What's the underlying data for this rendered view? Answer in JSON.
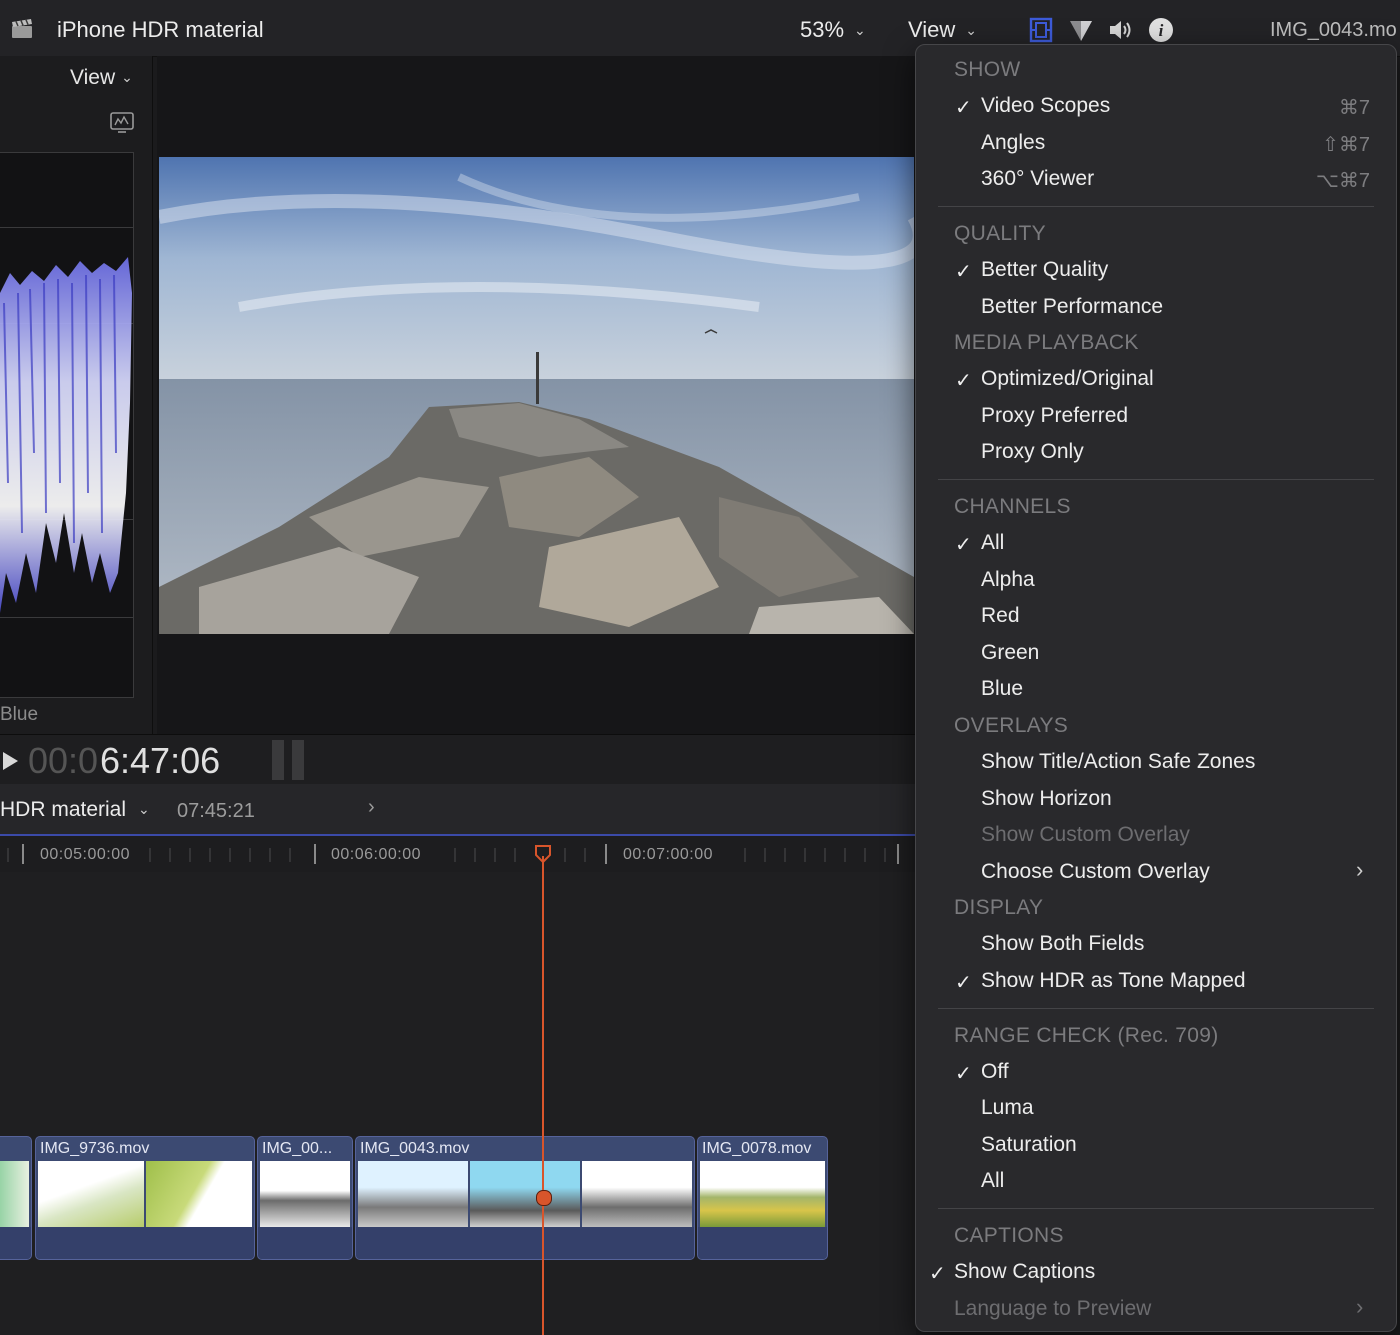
{
  "topbar": {
    "project_title": "iPhone HDR material",
    "zoom": "53%",
    "view_label": "View",
    "clip_name": "IMG_0043.mo",
    "accent_color": "#3d5bd9"
  },
  "scope": {
    "view_label": "View",
    "channel_label": "Blue"
  },
  "transport": {
    "timecode_dim": "00:0",
    "timecode_main": "6:47:06"
  },
  "timeline": {
    "project_name": "HDR material",
    "duration": "07:45:21",
    "ruler_labels": [
      "00:05:00:00",
      "00:06:00:00",
      "00:07:00:00"
    ],
    "clips": [
      {
        "name": ""
      },
      {
        "name": "IMG_9736.mov"
      },
      {
        "name": "IMG_00..."
      },
      {
        "name": "IMG_0043.mov"
      },
      {
        "name": "IMG_0078.mov"
      }
    ],
    "playhead_color": "#d8552b"
  },
  "menu": {
    "show": {
      "header": "SHOW",
      "items": [
        {
          "label": "Video Scopes",
          "checked": true,
          "shortcut": "⌘7"
        },
        {
          "label": "Angles",
          "checked": false,
          "shortcut": "⇧⌘7"
        },
        {
          "label": "360° Viewer",
          "checked": false,
          "shortcut": "⌥⌘7"
        }
      ]
    },
    "quality": {
      "header": "QUALITY",
      "items": [
        {
          "label": "Better Quality",
          "checked": true
        },
        {
          "label": "Better Performance",
          "checked": false
        }
      ]
    },
    "media_playback": {
      "header": "MEDIA PLAYBACK",
      "items": [
        {
          "label": "Optimized/Original",
          "checked": true
        },
        {
          "label": "Proxy Preferred",
          "checked": false
        },
        {
          "label": "Proxy Only",
          "checked": false
        }
      ]
    },
    "channels": {
      "header": "CHANNELS",
      "items": [
        {
          "label": "All",
          "checked": true
        },
        {
          "label": "Alpha",
          "checked": false
        },
        {
          "label": "Red",
          "checked": false
        },
        {
          "label": "Green",
          "checked": false
        },
        {
          "label": "Blue",
          "checked": false
        }
      ]
    },
    "overlays": {
      "header": "OVERLAYS",
      "items": [
        {
          "label": "Show Title/Action Safe Zones",
          "checked": false
        },
        {
          "label": "Show Horizon",
          "checked": false
        },
        {
          "label": "Show Custom Overlay",
          "checked": false,
          "disabled": true
        },
        {
          "label": "Choose Custom Overlay",
          "checked": false,
          "submenu": true
        }
      ]
    },
    "display": {
      "header": "DISPLAY",
      "items": [
        {
          "label": "Show Both Fields",
          "checked": false
        },
        {
          "label": "Show HDR as Tone Mapped",
          "checked": true
        }
      ]
    },
    "range_check": {
      "header": "RANGE CHECK (Rec. 709)",
      "items": [
        {
          "label": "Off",
          "checked": true
        },
        {
          "label": "Luma",
          "checked": false
        },
        {
          "label": "Saturation",
          "checked": false
        },
        {
          "label": "All",
          "checked": false
        }
      ]
    },
    "captions": {
      "header": "CAPTIONS",
      "items": [
        {
          "label": "Show Captions",
          "checked": true
        },
        {
          "label": "Language to Preview",
          "checked": false,
          "disabled": true,
          "submenu": true
        }
      ]
    },
    "check_glyph": "✓",
    "submenu_glyph": "›"
  }
}
